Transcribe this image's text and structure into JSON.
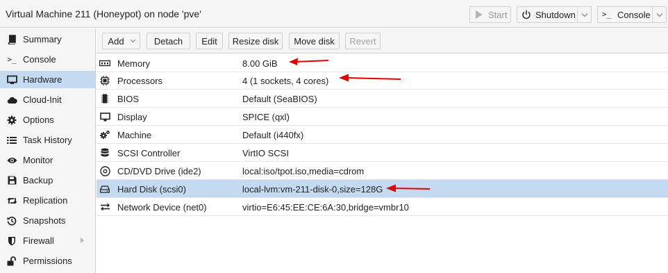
{
  "window": {
    "title": "Virtual Machine 211 (Honeypot) on node 'pve'"
  },
  "header_buttons": {
    "start": "Start",
    "shutdown": "Shutdown",
    "console": "Console"
  },
  "sidebar": {
    "items": [
      {
        "label": "Summary",
        "icon": "book-icon"
      },
      {
        "label": "Console",
        "icon": "terminal-icon"
      },
      {
        "label": "Hardware",
        "icon": "monitor-icon",
        "active": true
      },
      {
        "label": "Cloud-Init",
        "icon": "cloud-icon"
      },
      {
        "label": "Options",
        "icon": "gear-icon"
      },
      {
        "label": "Task History",
        "icon": "list-icon"
      },
      {
        "label": "Monitor",
        "icon": "eye-icon"
      },
      {
        "label": "Backup",
        "icon": "floppy-icon"
      },
      {
        "label": "Replication",
        "icon": "retweet-icon"
      },
      {
        "label": "Snapshots",
        "icon": "history-icon"
      },
      {
        "label": "Firewall",
        "icon": "shield-icon"
      },
      {
        "label": "Permissions",
        "icon": "unlock-icon"
      }
    ]
  },
  "toolbar": {
    "add": "Add",
    "detach": "Detach",
    "edit": "Edit",
    "resize_disk": "Resize disk",
    "move_disk": "Move disk",
    "revert": "Revert"
  },
  "hardware": {
    "rows": [
      {
        "key": "Memory",
        "value": "8.00 GiB",
        "icon": "memory-icon"
      },
      {
        "key": "Processors",
        "value": "4 (1 sockets, 4 cores)",
        "icon": "cpu-icon"
      },
      {
        "key": "BIOS",
        "value": "Default (SeaBIOS)",
        "icon": "chip-icon"
      },
      {
        "key": "Display",
        "value": "SPICE (qxl)",
        "icon": "desktop-icon"
      },
      {
        "key": "Machine",
        "value": "Default (i440fx)",
        "icon": "cogs-icon"
      },
      {
        "key": "SCSI Controller",
        "value": "VirtIO SCSI",
        "icon": "database-icon"
      },
      {
        "key": "CD/DVD Drive (ide2)",
        "value": "local:iso/tpot.iso,media=cdrom",
        "icon": "cdrom-icon"
      },
      {
        "key": "Hard Disk (scsi0)",
        "value": "local-lvm:vm-211-disk-0,size=128G",
        "icon": "hdd-icon",
        "selected": true
      },
      {
        "key": "Network Device (net0)",
        "value": "virtio=E6:45:EE:CE:6A:30,bridge=vmbr10",
        "icon": "exchange-icon"
      }
    ]
  },
  "colors": {
    "selection": "#c3daf0",
    "annotation_arrow": "#e00000",
    "panel_bg": "#f5f5f5"
  }
}
